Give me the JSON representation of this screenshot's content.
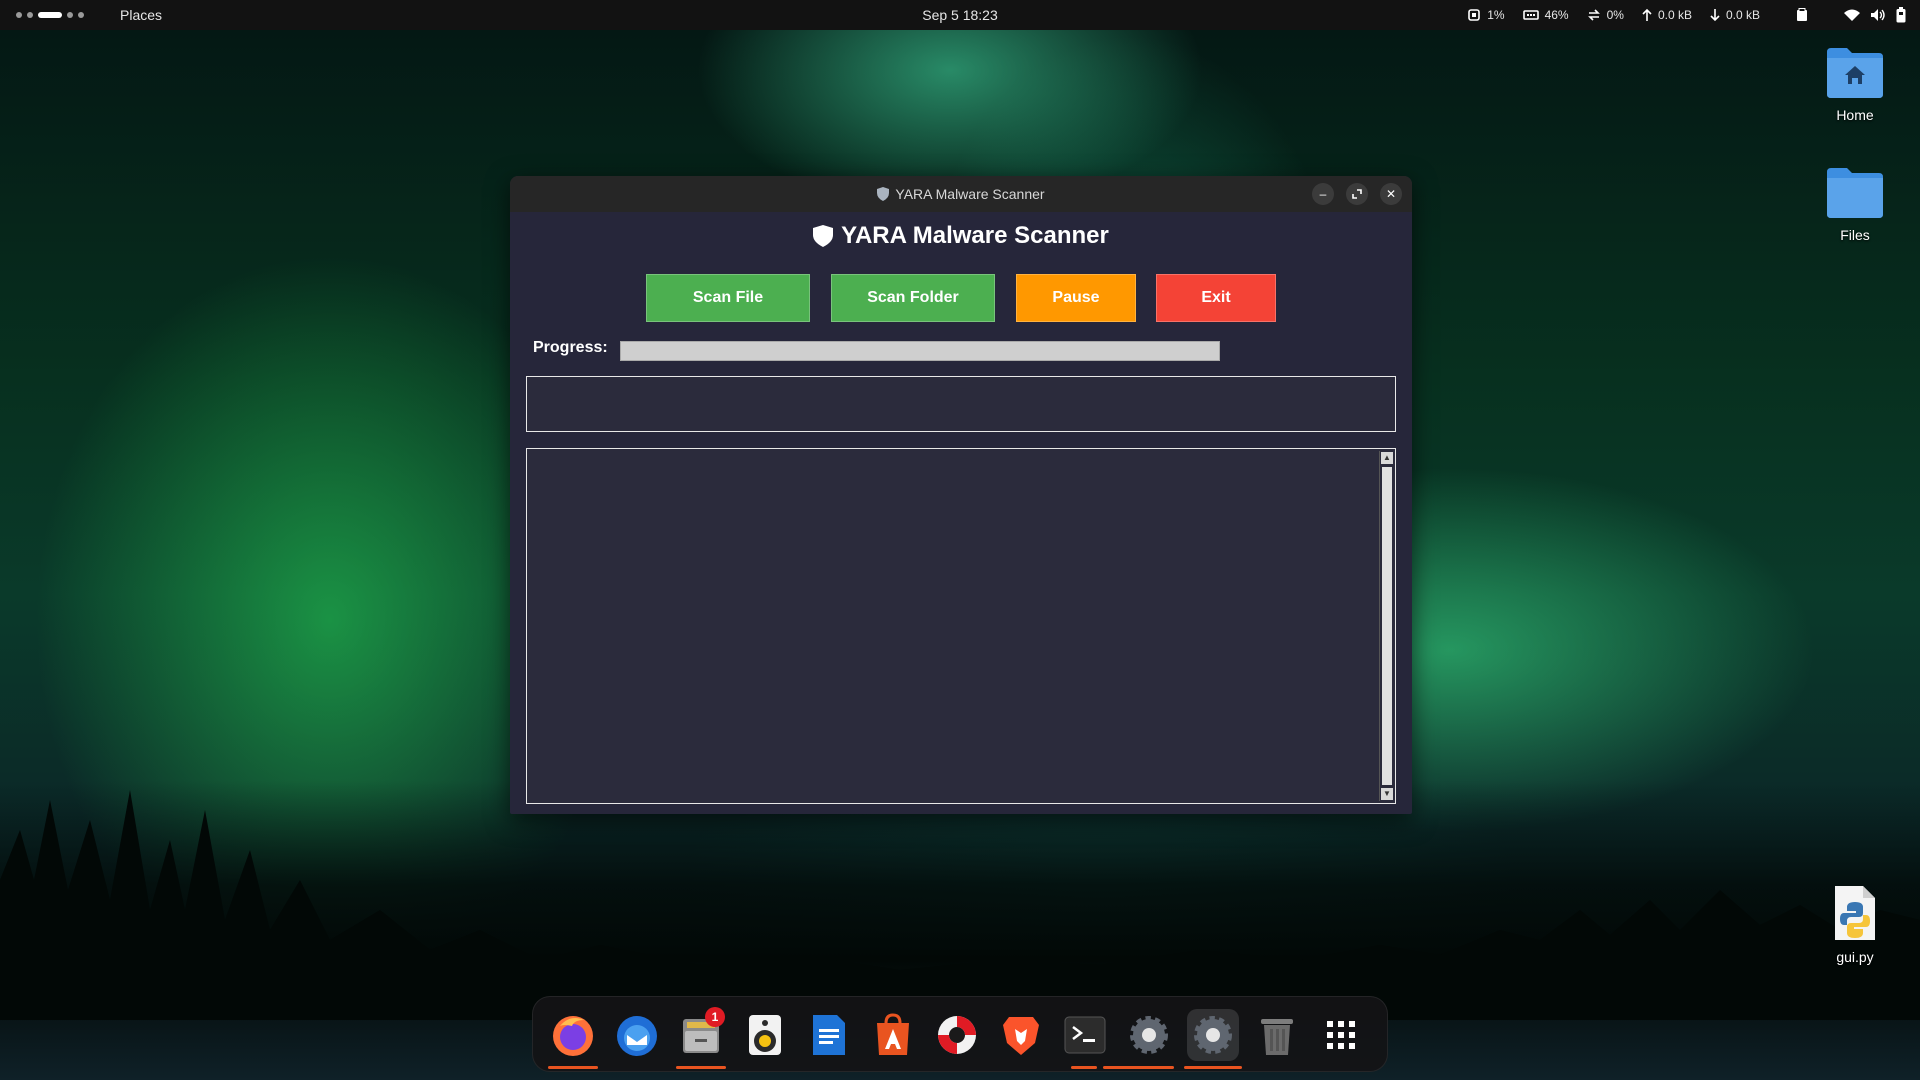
{
  "topbar": {
    "places_label": "Places",
    "datetime": "Sep 5  18:23",
    "cpu": "1%",
    "memory": "46%",
    "swap": "0%",
    "upload": "0.0 kB",
    "download": "0.0 kB"
  },
  "desktop": {
    "icons": [
      {
        "label": "Home",
        "icon": "home-folder-icon"
      },
      {
        "label": "Files",
        "icon": "folder-icon"
      },
      {
        "label": "gui.py",
        "icon": "python-file-icon"
      }
    ]
  },
  "window": {
    "titlebar": "YARA Malware Scanner",
    "heading": "YARA Malware Scanner",
    "buttons": {
      "scan_file": "Scan File",
      "scan_folder": "Scan Folder",
      "pause": "Pause",
      "exit": "Exit"
    },
    "progress_label": "Progress:",
    "progress_value": 0,
    "status_text": "",
    "log_text": "",
    "colors": {
      "green": "#4caf50",
      "orange": "#ff9800",
      "red": "#f44336",
      "background": "#26263a"
    }
  },
  "dock": {
    "apps": [
      {
        "name": "firefox",
        "running": true
      },
      {
        "name": "thunderbird",
        "running": false
      },
      {
        "name": "files",
        "running": true,
        "badge": "1"
      },
      {
        "name": "rhythmbox",
        "running": false
      },
      {
        "name": "libreoffice-writer",
        "running": false
      },
      {
        "name": "app-center",
        "running": false
      },
      {
        "name": "help",
        "running": false
      },
      {
        "name": "brave",
        "running": false
      },
      {
        "name": "terminal",
        "running": true
      },
      {
        "name": "settings",
        "running": true
      },
      {
        "name": "python-app",
        "running": true,
        "focused": true
      },
      {
        "name": "trash",
        "running": false
      },
      {
        "name": "show-apps",
        "running": false
      }
    ]
  }
}
